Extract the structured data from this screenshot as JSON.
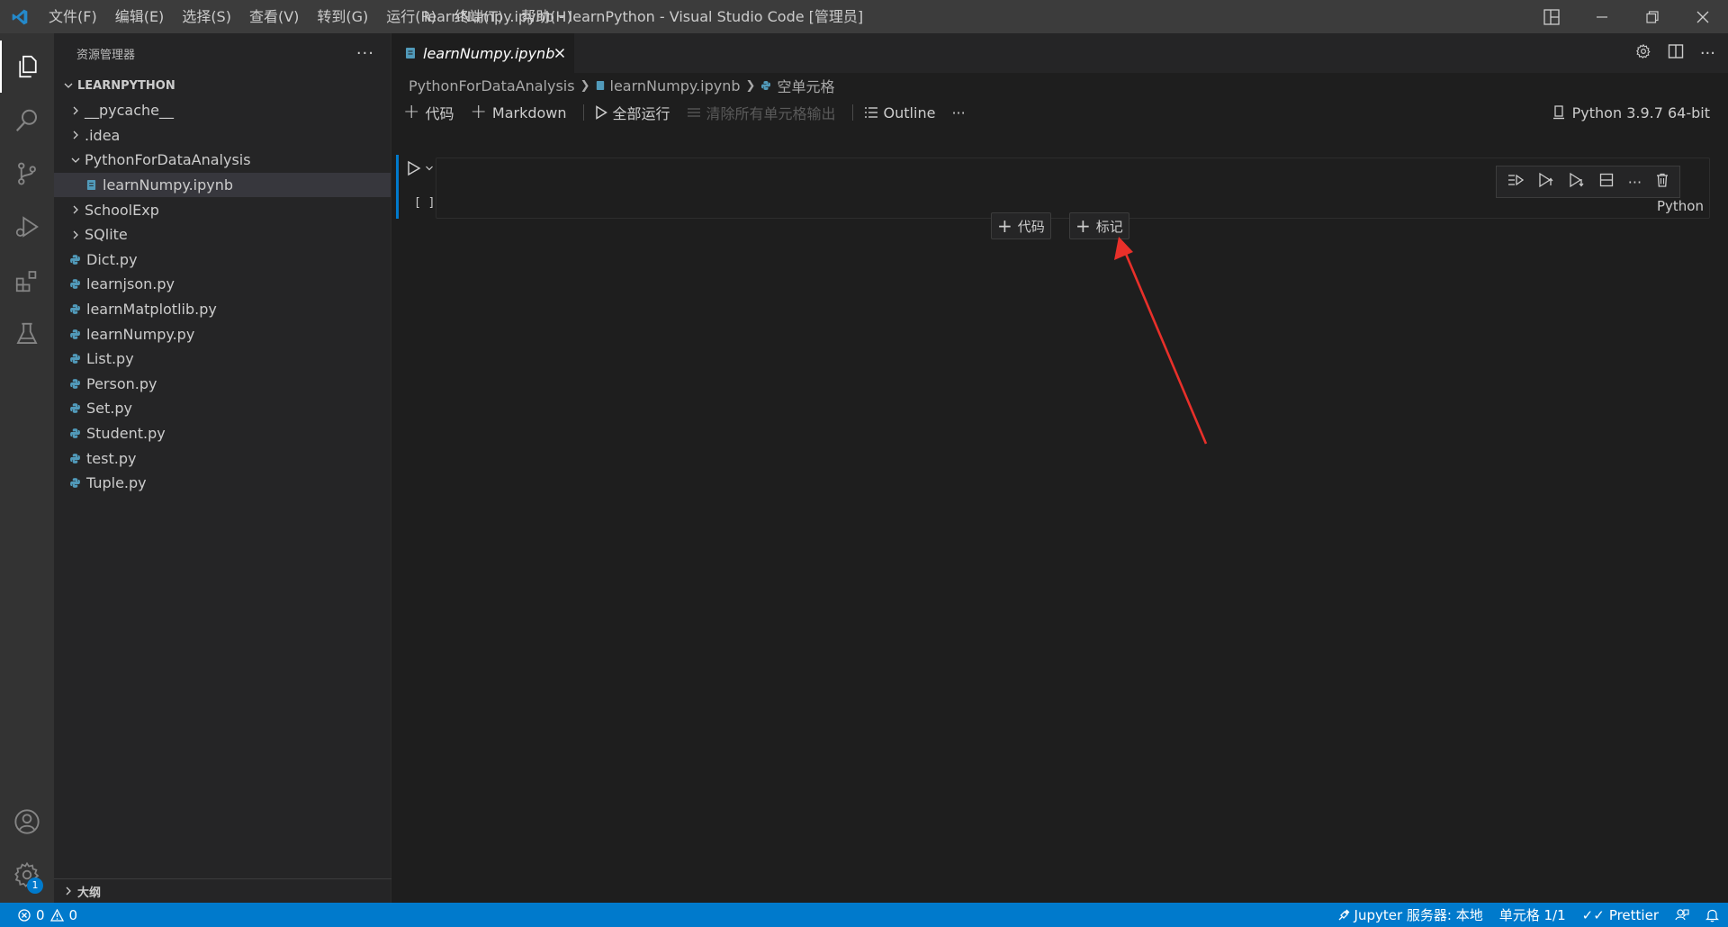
{
  "titlebar": {
    "menus": [
      "文件(F)",
      "编辑(E)",
      "选择(S)",
      "查看(V)",
      "转到(G)",
      "运行(R)",
      "终端(T)",
      "帮助(H)"
    ],
    "window_title": "learnNumpy.ipynb - learnPython - Visual Studio Code [管理员]"
  },
  "sidebar": {
    "title": "资源管理器",
    "more": "···",
    "workspace": "LEARNPYTHON",
    "items": [
      {
        "label": "__pycache__",
        "kind": "folder",
        "expanded": false,
        "depth": 0
      },
      {
        "label": ".idea",
        "kind": "folder",
        "expanded": false,
        "depth": 0
      },
      {
        "label": "PythonForDataAnalysis",
        "kind": "folder",
        "expanded": true,
        "depth": 0
      },
      {
        "label": "learnNumpy.ipynb",
        "kind": "notebook",
        "depth": 1,
        "selected": true
      },
      {
        "label": "SchoolExp",
        "kind": "folder",
        "expanded": false,
        "depth": 0
      },
      {
        "label": "SQlite",
        "kind": "folder",
        "expanded": false,
        "depth": 0
      },
      {
        "label": "Dict.py",
        "kind": "python",
        "depth": 0
      },
      {
        "label": "learnjson.py",
        "kind": "python",
        "depth": 0
      },
      {
        "label": "learnMatplotlib.py",
        "kind": "python",
        "depth": 0
      },
      {
        "label": "learnNumpy.py",
        "kind": "python",
        "depth": 0
      },
      {
        "label": "List.py",
        "kind": "python",
        "depth": 0
      },
      {
        "label": "Person.py",
        "kind": "python",
        "depth": 0
      },
      {
        "label": "Set.py",
        "kind": "python",
        "depth": 0
      },
      {
        "label": "Student.py",
        "kind": "python",
        "depth": 0
      },
      {
        "label": "test.py",
        "kind": "python",
        "depth": 0
      },
      {
        "label": "Tuple.py",
        "kind": "python",
        "depth": 0
      }
    ],
    "outline_label": "大纲"
  },
  "editor": {
    "tab_label": "learnNumpy.ipynb",
    "breadcrumb": [
      "PythonForDataAnalysis",
      "learnNumpy.ipynb",
      "空单元格"
    ],
    "toolbar": {
      "add_code": "代码",
      "add_markdown": "Markdown",
      "run_all": "全部运行",
      "clear_outputs": "清除所有单元格输出",
      "outline": "Outline",
      "more": "···"
    },
    "kernel": "Python 3.9.7 64-bit",
    "cell": {
      "exec_count": "[ ]",
      "language": "Python"
    },
    "insert_code": "代码",
    "insert_markdown": "标记"
  },
  "statusbar": {
    "errors": "0",
    "warnings": "0",
    "jupyter": "Jupyter 服务器: 本地",
    "cell_pos": "单元格 1/1",
    "prettier": "Prettier"
  },
  "colors": {
    "accent": "#007acc",
    "annotation_arrow": "#e8302a",
    "python_icon": "#519aba"
  },
  "account_badge": "1"
}
